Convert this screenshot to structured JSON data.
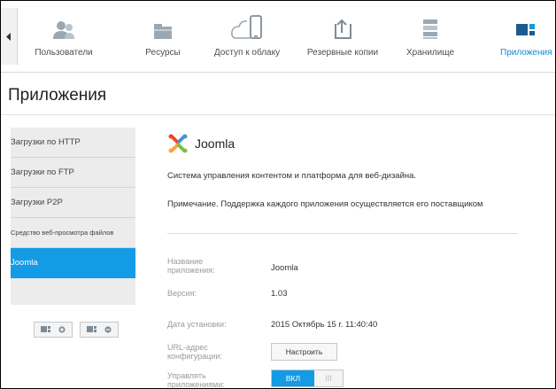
{
  "nav": {
    "items": [
      {
        "label": "Пользователи",
        "icon": "users-icon"
      },
      {
        "label": "Ресурсы",
        "icon": "folder-icon"
      },
      {
        "label": "Доступ к облаку",
        "icon": "cloud-device-icon"
      },
      {
        "label": "Резервные копии",
        "icon": "backup-icon"
      },
      {
        "label": "Хранилище",
        "icon": "storage-icon"
      },
      {
        "label": "Приложения",
        "icon": "apps-icon",
        "active": true
      }
    ],
    "active_color": "#0d8ad6"
  },
  "page": {
    "title": "Приложения"
  },
  "sidebar": {
    "items": [
      {
        "label": "Загрузки по HTTP"
      },
      {
        "label": "Загрузки по FTP"
      },
      {
        "label": "Загрузки P2P"
      },
      {
        "label": "Средство веб-просмотра файлов"
      },
      {
        "label": "Joomla",
        "active": true
      }
    ],
    "active_color": "#139be5"
  },
  "app": {
    "name": "Joomla",
    "description": "Система управления контентом и платформа для веб-дизайна.",
    "note": "Примечание. Поддержка каждого приложения осуществляется его поставщиком",
    "fields": {
      "name_label": "Название приложения:",
      "name_value": "Joomla",
      "version_label": "Версия:",
      "version_value": "1.03",
      "install_label": "Дата установки:",
      "install_value": "2015 Октябрь 15 г. 11:40:40",
      "config_label": "URL-адрес конфигурации:",
      "config_button": "Настроить",
      "manage_label": "Управлять приложениями:",
      "toggle_on": "ВКЛ",
      "toggle_grip": "III"
    }
  }
}
